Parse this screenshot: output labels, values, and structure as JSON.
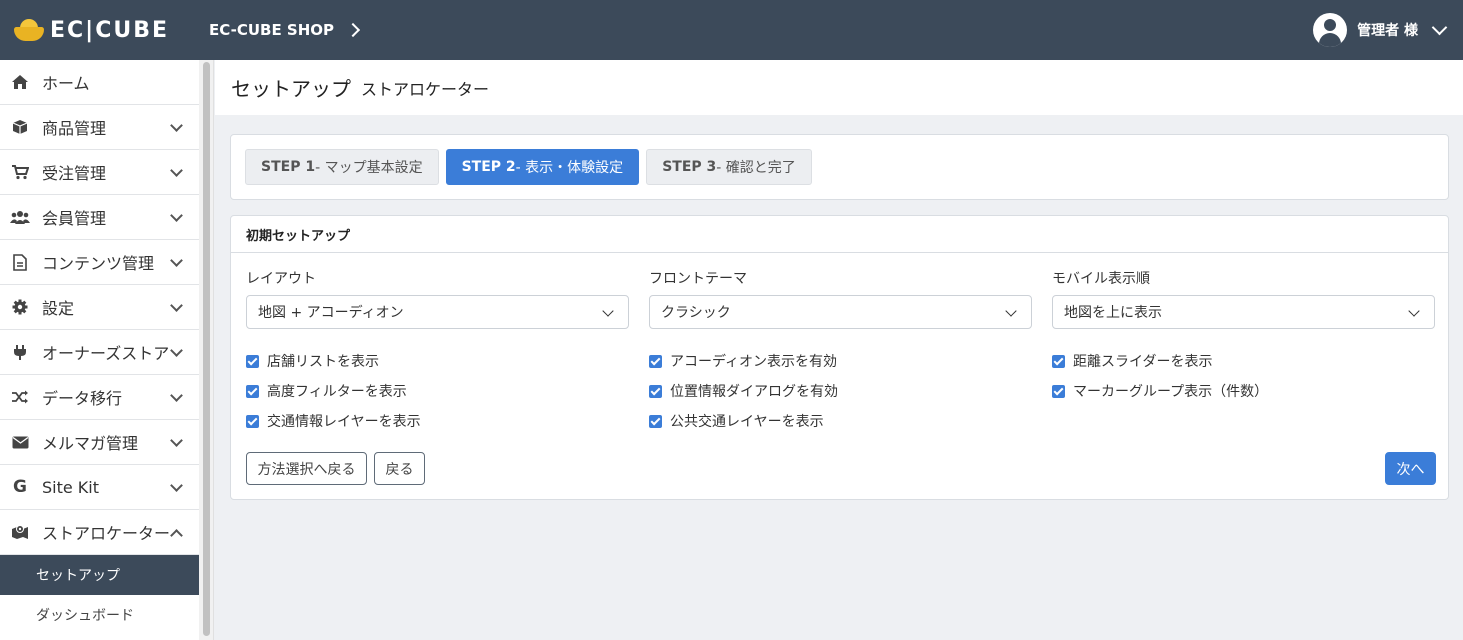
{
  "header": {
    "logo_text": "EC|CUBE",
    "shop_name": "EC-CUBE SHOP",
    "user_name": "管理者 様"
  },
  "sidebar": {
    "items": [
      {
        "label": "ホーム",
        "icon": "home-icon"
      },
      {
        "label": "商品管理",
        "icon": "box-icon"
      },
      {
        "label": "受注管理",
        "icon": "cart-icon"
      },
      {
        "label": "会員管理",
        "icon": "users-icon"
      },
      {
        "label": "コンテンツ管理",
        "icon": "file-icon"
      },
      {
        "label": "設定",
        "icon": "gear-icon"
      },
      {
        "label": "オーナーズストア",
        "icon": "plug-icon"
      },
      {
        "label": "データ移行",
        "icon": "shuffle-icon"
      },
      {
        "label": "メルマガ管理",
        "icon": "envelope-icon"
      },
      {
        "label": "Site Kit",
        "icon": "google-icon"
      },
      {
        "label": "ストアロケーター",
        "icon": "map-icon"
      }
    ],
    "sub_items": [
      {
        "label": "セットアップ",
        "active": true
      },
      {
        "label": "ダッシュボード",
        "active": false
      }
    ]
  },
  "page": {
    "title": "セットアップ",
    "subtitle": "ストアロケーター"
  },
  "steps": [
    {
      "num": "STEP 1",
      "label": " - マップ基本設定",
      "active": false
    },
    {
      "num": "STEP 2",
      "label": " - 表示・体験設定",
      "active": true
    },
    {
      "num": "STEP 3",
      "label": " - 確認と完了",
      "active": false
    }
  ],
  "form": {
    "card_title": "初期セットアップ",
    "columns": [
      {
        "label": "レイアウト",
        "select_value": "地図 + アコーディオン",
        "checks": [
          "店舗リストを表示",
          "高度フィルターを表示",
          "交通情報レイヤーを表示"
        ]
      },
      {
        "label": "フロントテーマ",
        "select_value": "クラシック",
        "checks": [
          "アコーディオン表示を有効",
          "位置情報ダイアログを有効",
          "公共交通レイヤーを表示"
        ]
      },
      {
        "label": "モバイル表示順",
        "select_value": "地図を上に表示",
        "checks": [
          "距離スライダーを表示",
          "マーカーグループ表示（件数）"
        ]
      }
    ],
    "buttons": {
      "back_method": "方法選択へ戻る",
      "back": "戻る",
      "next": "次へ"
    }
  },
  "colors": {
    "header_bg": "#3c4a5a",
    "accent": "#3b7dd8",
    "logo_gold": "#e9b323"
  }
}
